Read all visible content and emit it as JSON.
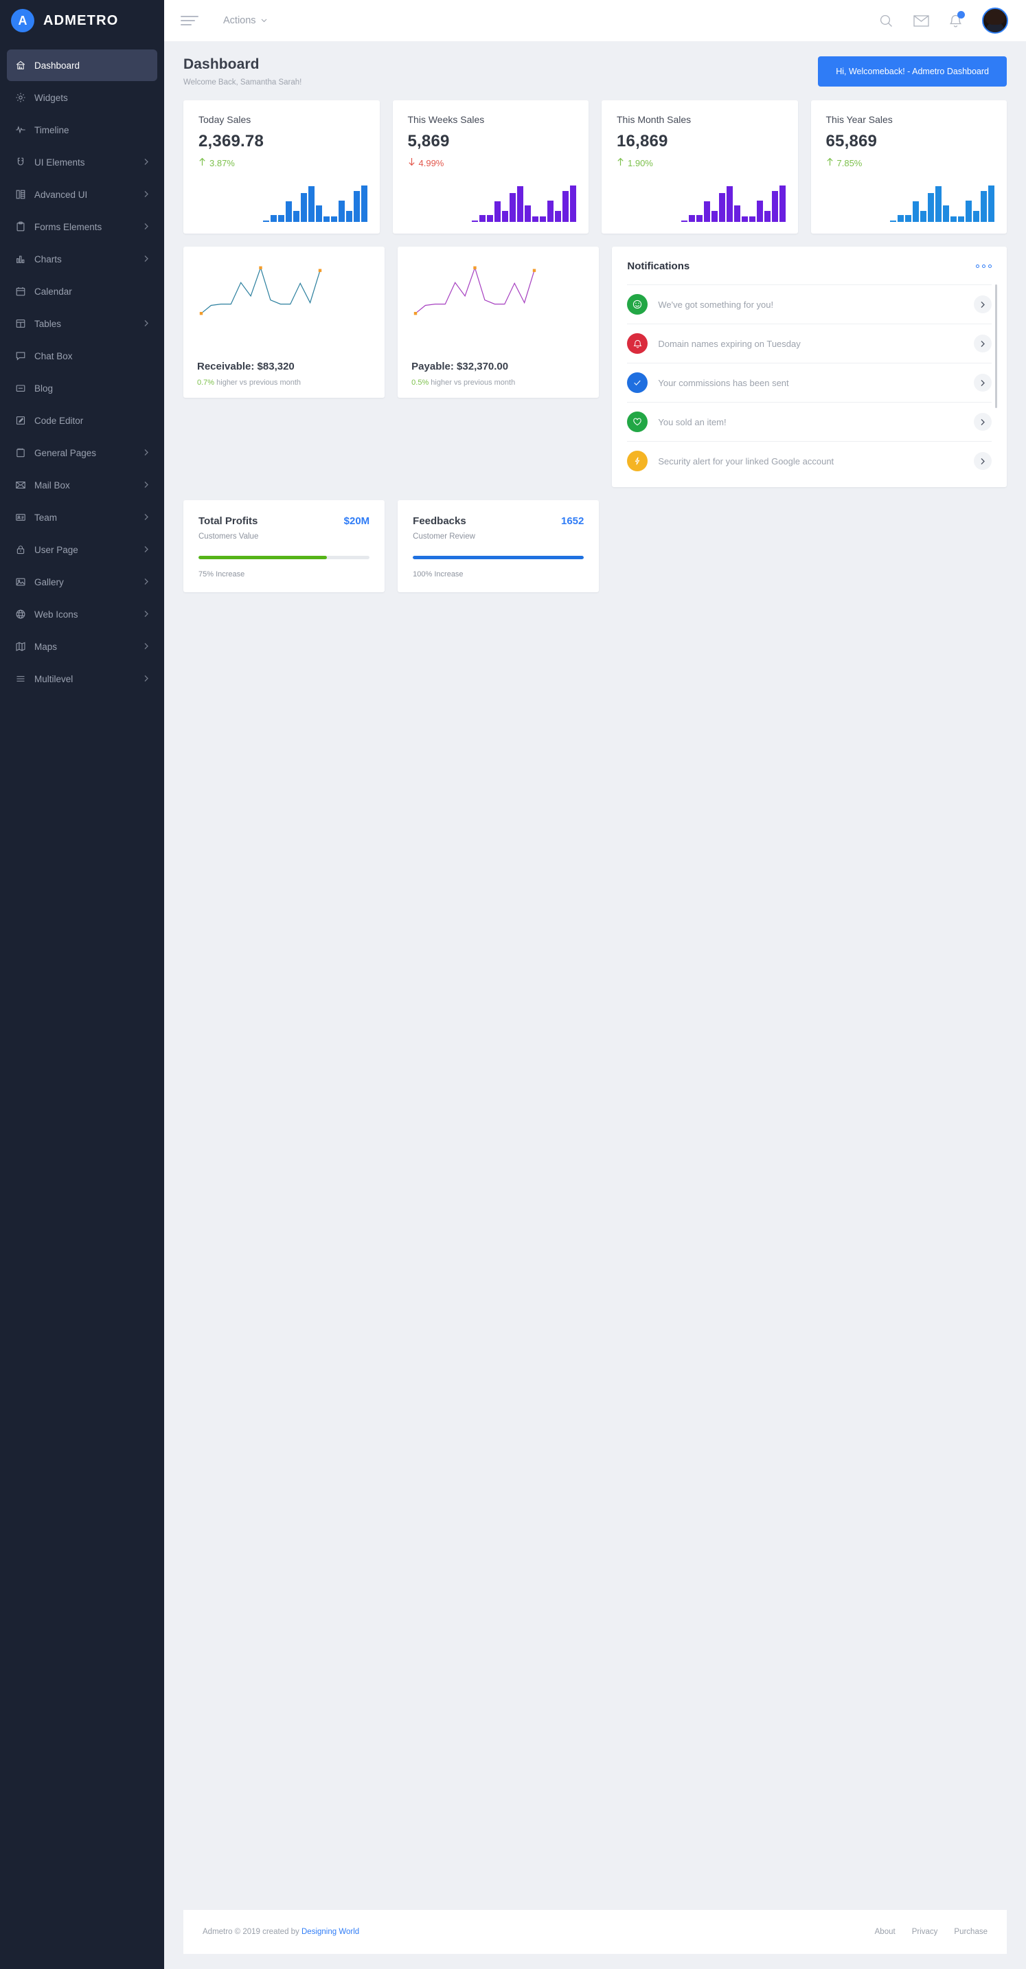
{
  "brand": {
    "initial": "A",
    "name": "ADMETRO"
  },
  "sidebar": {
    "items": [
      {
        "label": "Dashboard",
        "icon": "home-icon",
        "active": true,
        "chevron": false
      },
      {
        "label": "Widgets",
        "icon": "gear-icon",
        "active": false,
        "chevron": false
      },
      {
        "label": "Timeline",
        "icon": "pulse-icon",
        "active": false,
        "chevron": false
      },
      {
        "label": "UI Elements",
        "icon": "magnet-icon",
        "active": false,
        "chevron": true
      },
      {
        "label": "Advanced UI",
        "icon": "columns-icon",
        "active": false,
        "chevron": true
      },
      {
        "label": "Forms Elements",
        "icon": "clipboard-icon",
        "active": false,
        "chevron": true
      },
      {
        "label": "Charts",
        "icon": "bar-chart-icon",
        "active": false,
        "chevron": true
      },
      {
        "label": "Calendar",
        "icon": "calendar-icon",
        "active": false,
        "chevron": false
      },
      {
        "label": "Tables",
        "icon": "table-icon",
        "active": false,
        "chevron": true
      },
      {
        "label": "Chat Box",
        "icon": "chat-icon",
        "active": false,
        "chevron": false
      },
      {
        "label": "Blog",
        "icon": "blog-icon",
        "active": false,
        "chevron": false
      },
      {
        "label": "Code Editor",
        "icon": "pencil-icon",
        "active": false,
        "chevron": false
      },
      {
        "label": "General Pages",
        "icon": "notebook-icon",
        "active": false,
        "chevron": true
      },
      {
        "label": "Mail Box",
        "icon": "envelope-icon",
        "active": false,
        "chevron": true
      },
      {
        "label": "Team",
        "icon": "id-card-icon",
        "active": false,
        "chevron": true
      },
      {
        "label": "User Page",
        "icon": "lock-icon",
        "active": false,
        "chevron": true
      },
      {
        "label": "Gallery",
        "icon": "image-icon",
        "active": false,
        "chevron": true
      },
      {
        "label": "Web Icons",
        "icon": "globe-icon",
        "active": false,
        "chevron": true
      },
      {
        "label": "Maps",
        "icon": "map-icon",
        "active": false,
        "chevron": true
      },
      {
        "label": "Multilevel",
        "icon": "list-icon",
        "active": false,
        "chevron": true
      }
    ]
  },
  "topbar": {
    "actions_label": "Actions",
    "bell_badge": "",
    "icons": [
      "search-icon",
      "mail-icon",
      "bell-icon",
      "avatar"
    ]
  },
  "page": {
    "title": "Dashboard",
    "subtitle": "Welcome Back, Samantha Sarah!",
    "welcome_button": "Hi, Welcomeback! - Admetro Dashboard"
  },
  "stats": [
    {
      "title": "Today Sales",
      "value": "2,369.78",
      "delta": "3.87%",
      "direction": "up",
      "color": "#1f7ae0",
      "delta_color": "#7cc04b"
    },
    {
      "title": "This Weeks Sales",
      "value": "5,869",
      "delta": "4.99%",
      "direction": "down",
      "color": "#6a1fe0",
      "delta_color": "#e2574c"
    },
    {
      "title": "This Month Sales",
      "value": "16,869",
      "delta": "1.90%",
      "direction": "up",
      "color": "#6a1fe0",
      "delta_color": "#7cc04b"
    },
    {
      "title": "This Year Sales",
      "value": "65,869",
      "delta": "7.85%",
      "direction": "up",
      "color": "#1f8ae0",
      "delta_color": "#7cc04b"
    }
  ],
  "chart_data": [
    {
      "type": "bar",
      "title": "Today Sales",
      "categories": [
        "1",
        "2",
        "3",
        "4",
        "5",
        "6",
        "7",
        "8",
        "9",
        "10",
        "11",
        "12",
        "13",
        "14"
      ],
      "values": [
        2,
        8,
        8,
        25,
        13,
        35,
        43,
        20,
        7,
        7,
        26,
        13,
        37,
        44
      ],
      "ylim": [
        0,
        48
      ],
      "color": "#1f7ae0"
    },
    {
      "type": "bar",
      "title": "This Weeks Sales",
      "categories": [
        "1",
        "2",
        "3",
        "4",
        "5",
        "6",
        "7",
        "8",
        "9",
        "10",
        "11",
        "12",
        "13",
        "14"
      ],
      "values": [
        2,
        8,
        8,
        25,
        13,
        35,
        43,
        20,
        7,
        7,
        26,
        13,
        37,
        44
      ],
      "ylim": [
        0,
        48
      ],
      "color": "#6a1fe0"
    },
    {
      "type": "bar",
      "title": "This Month Sales",
      "categories": [
        "1",
        "2",
        "3",
        "4",
        "5",
        "6",
        "7",
        "8",
        "9",
        "10",
        "11",
        "12",
        "13",
        "14"
      ],
      "values": [
        2,
        8,
        8,
        25,
        13,
        35,
        43,
        20,
        7,
        7,
        26,
        13,
        37,
        44
      ],
      "ylim": [
        0,
        48
      ],
      "color": "#6a1fe0"
    },
    {
      "type": "bar",
      "title": "This Year Sales",
      "categories": [
        "1",
        "2",
        "3",
        "4",
        "5",
        "6",
        "7",
        "8",
        "9",
        "10",
        "11",
        "12",
        "13",
        "14"
      ],
      "values": [
        2,
        8,
        8,
        25,
        13,
        35,
        43,
        20,
        7,
        7,
        26,
        13,
        37,
        44
      ],
      "ylim": [
        0,
        48
      ],
      "color": "#1f8ae0"
    },
    {
      "type": "line",
      "title": "Receivable",
      "x": [
        0,
        1,
        2,
        3,
        4,
        5,
        6,
        7,
        8,
        9,
        10,
        11,
        12
      ],
      "values": [
        10,
        22,
        24,
        24,
        56,
        36,
        78,
        30,
        24,
        24,
        55,
        26,
        74
      ],
      "ylim": [
        0,
        85
      ],
      "color": "#2b7f9e",
      "marker_color": "#f39c2b",
      "markers": [
        0,
        6,
        12
      ]
    },
    {
      "type": "line",
      "title": "Payable",
      "x": [
        0,
        1,
        2,
        3,
        4,
        5,
        6,
        7,
        8,
        9,
        10,
        11,
        12
      ],
      "values": [
        10,
        22,
        24,
        24,
        56,
        36,
        78,
        30,
        24,
        24,
        55,
        26,
        74
      ],
      "ylim": [
        0,
        85
      ],
      "color": "#a63fc0",
      "marker_color": "#f39c2b",
      "markers": [
        0,
        6,
        12
      ]
    }
  ],
  "lines": [
    {
      "title": "Receivable: $83,320",
      "pct": "0.7%",
      "sub": " higher vs previous month"
    },
    {
      "title": "Payable: $32,370.00",
      "pct": "0.5%",
      "sub": " higher vs previous month"
    }
  ],
  "notifications": {
    "title": "Notifications",
    "items": [
      {
        "text": "We've got something for you!",
        "icon": "smiley-icon",
        "color": "#22a745"
      },
      {
        "text": "Domain names expiring on Tuesday",
        "icon": "bell-icon",
        "color": "#da2b3d"
      },
      {
        "text": "Your commissions has been sent",
        "icon": "check-icon",
        "color": "#1f6fe0"
      },
      {
        "text": "You sold an item!",
        "icon": "heart-icon",
        "color": "#22a745"
      },
      {
        "text": "Security alert for your linked Google account",
        "icon": "bolt-icon",
        "color": "#f5b423"
      }
    ]
  },
  "progress": [
    {
      "title": "Total Profits",
      "value": "$20M",
      "sub": "Customers Value",
      "pct": 75,
      "note": "75% Increase",
      "color": "#55b418"
    },
    {
      "title": "Feedbacks",
      "value": "1652",
      "sub": "Customer Review",
      "pct": 100,
      "note": "100% Increase",
      "color": "#1f71e0"
    }
  ],
  "footer": {
    "copyright": "Admetro © 2019 created by ",
    "author": "Designing World",
    "links": [
      "About",
      "Privacy",
      "Purchase"
    ]
  }
}
